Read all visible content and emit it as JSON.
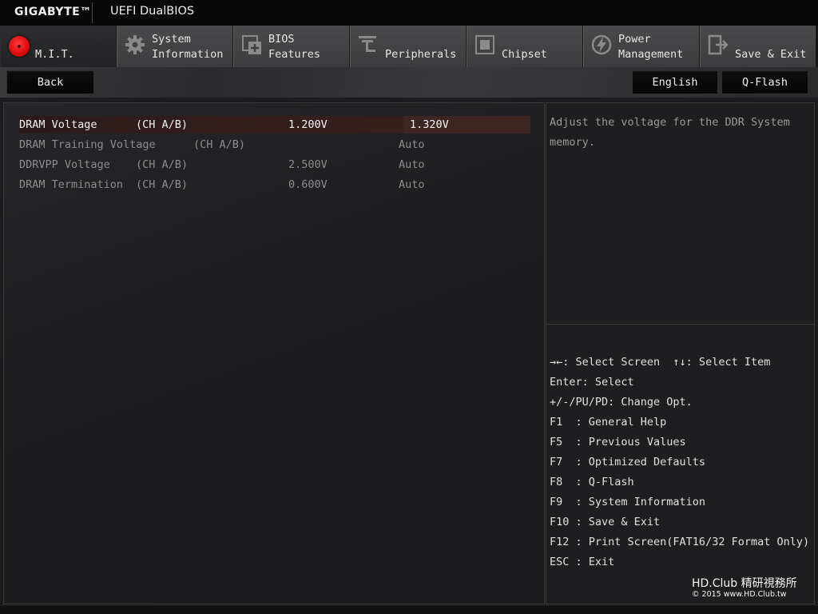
{
  "header": {
    "brand": "GIGABYTE™",
    "product": "UEFI DualBIOS"
  },
  "tabs": [
    {
      "label": "M.I.T.",
      "icon": "mit-red-dot-icon",
      "active": true
    },
    {
      "label": "System\nInformation",
      "icon": "gear-icon"
    },
    {
      "label": "BIOS\nFeatures",
      "icon": "bios-chip-icon"
    },
    {
      "label": "Peripherals",
      "icon": "peripherals-icon"
    },
    {
      "label": "Chipset",
      "icon": "chipset-icon"
    },
    {
      "label": "Power\nManagement",
      "icon": "power-icon"
    },
    {
      "label": "Save & Exit",
      "icon": "exit-door-icon"
    }
  ],
  "toolbar": {
    "back_label": "Back",
    "language_label": "English",
    "qflash_label": "Q-Flash"
  },
  "settings": [
    {
      "name": "DRAM Voltage",
      "channel": "(CH A/B)",
      "current": "1.200V",
      "value": "1.320V",
      "selected": true
    },
    {
      "name": "DRAM Training Voltage",
      "channel": "(CH A/B)",
      "current": "",
      "value": "Auto"
    },
    {
      "name": "DDRVPP Voltage",
      "channel": "(CH A/B)",
      "current": "2.500V",
      "value": "Auto"
    },
    {
      "name": "DRAM Termination",
      "channel": "(CH A/B)",
      "current": "0.600V",
      "value": "Auto"
    }
  ],
  "help_text": "Adjust the voltage for the DDR System memory.",
  "keys": [
    "→←: Select Screen  ↑↓: Select Item",
    "Enter: Select",
    "+/-/PU/PD: Change Opt.",
    "F1  : General Help",
    "F5  : Previous Values",
    "F7  : Optimized Defaults",
    "F8  : Q-Flash",
    "F9  : System Information",
    "F10 : Save & Exit",
    "F12 : Print Screen(FAT16/32 Format Only)",
    "ESC : Exit"
  ],
  "watermark": {
    "line1": "HD.Club 精研視務所",
    "line2": "© 2015  www.HD.Club.tw"
  }
}
